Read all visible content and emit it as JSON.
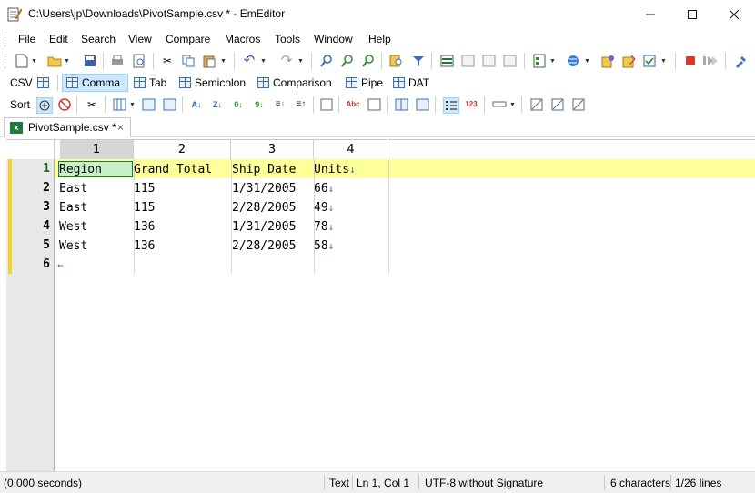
{
  "window": {
    "title": "C:\\Users\\jp\\Downloads\\PivotSample.csv * - EmEditor"
  },
  "menu": [
    "File",
    "Edit",
    "Search",
    "View",
    "Compare",
    "Macros",
    "Tools",
    "Window",
    "Help"
  ],
  "csv_toolbar": {
    "label": "CSV",
    "modes": [
      "Comma",
      "Tab",
      "Semicolon",
      "Comparison",
      "Pipe",
      "DAT"
    ],
    "active": "Comma"
  },
  "sort_toolbar": {
    "label": "Sort"
  },
  "document_tab": {
    "label": "PivotSample.csv *",
    "close": "×"
  },
  "grid": {
    "column_headers": [
      "1",
      "2",
      "3",
      "4"
    ],
    "line_numbers": [
      "1",
      "2",
      "3",
      "4",
      "5",
      "6"
    ],
    "rows": [
      [
        "Region",
        "Grand Total",
        "Ship Date",
        "Units"
      ],
      [
        "East",
        "115",
        "1/31/2005",
        "66"
      ],
      [
        "East",
        "115",
        "2/28/2005",
        "49"
      ],
      [
        "West",
        "136",
        "1/31/2005",
        "78"
      ],
      [
        "West",
        "136",
        "2/28/2005",
        "58"
      ]
    ],
    "newline_glyph": "↓",
    "eof_glyph": "←"
  },
  "status": {
    "time": "(0.000 seconds)",
    "mode": "Text",
    "position": "Ln 1, Col 1",
    "encoding": "UTF-8 without Signature",
    "selection": "6 characters",
    "lines": "1/26 lines"
  },
  "colors": {
    "current_line": "#ffff99",
    "selected_cell": "#c8f0c8",
    "line_number": "#1a6e1a",
    "modified_marker": "#f5d32a"
  }
}
